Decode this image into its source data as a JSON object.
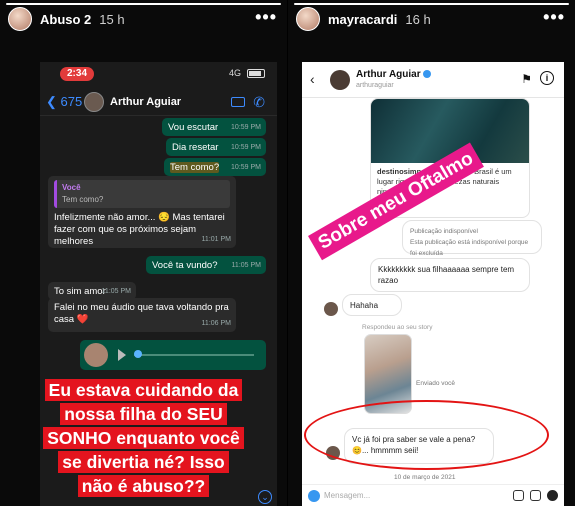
{
  "left_story": {
    "username": "Abuso 2",
    "time": "15 h",
    "more": "•••",
    "whatsapp": {
      "clock": "2:34",
      "network": "4G",
      "back_count": "675",
      "contact": "Arthur Aguiar",
      "messages": [
        {
          "dir": "out",
          "text": "Vou escutar",
          "time": "10:59 PM"
        },
        {
          "dir": "out",
          "text": "Dia resetar",
          "time": "10:59 PM"
        },
        {
          "dir": "out",
          "text": "Tem como?",
          "time": "10:59 PM"
        },
        {
          "dir": "in",
          "quote_name": "Você",
          "quote_text": "Tem como?",
          "text": "Infelizmente não amor... 😔 Mas tentarei fazer com que os próximos sejam melhores",
          "time": "11:01 PM"
        },
        {
          "dir": "out",
          "text": "Você ta vundo?",
          "time": "11:05 PM"
        },
        {
          "dir": "in",
          "text": "To sim amor",
          "time": "11:05 PM"
        },
        {
          "dir": "in",
          "text": "Falei no meu áudio que tava voltando pra casa ❤️",
          "time": "11:06 PM"
        }
      ]
    },
    "caption_lines": [
      "Eu estava cuidando da",
      "nossa filha do SEU",
      "SONHO enquanto você",
      "se divertia né? Isso",
      "não é abuso??"
    ]
  },
  "right_story": {
    "username": "mayracardi",
    "time": "16 h",
    "more": "•••",
    "instagram": {
      "name": "Arthur Aguiar",
      "handle": "arthuraguiar",
      "post_user": "destinosimperdiveis",
      "post_caption": "Que o Brasil é um lugar riquíssimo em belezas naturais ninguém tem",
      "unavailable_title": "Publicação indisponível",
      "unavailable_text": "Esta publicação está indisponível porque foi excluída",
      "msg1": "Kkkkkkkkk sua filhaaaaaa sempre tem razao",
      "msg2": "Hahaha",
      "replied_label": "Respondeu ao seu story",
      "seen_label": "Enviado você",
      "msg3": "Vc já foi pra saber se vale a pena? 😊... hmmmm seii!",
      "date_label": "10 de março de 2021",
      "input_placeholder": "Mensagem..."
    },
    "tag": "Sobre meu Oftalmo"
  }
}
